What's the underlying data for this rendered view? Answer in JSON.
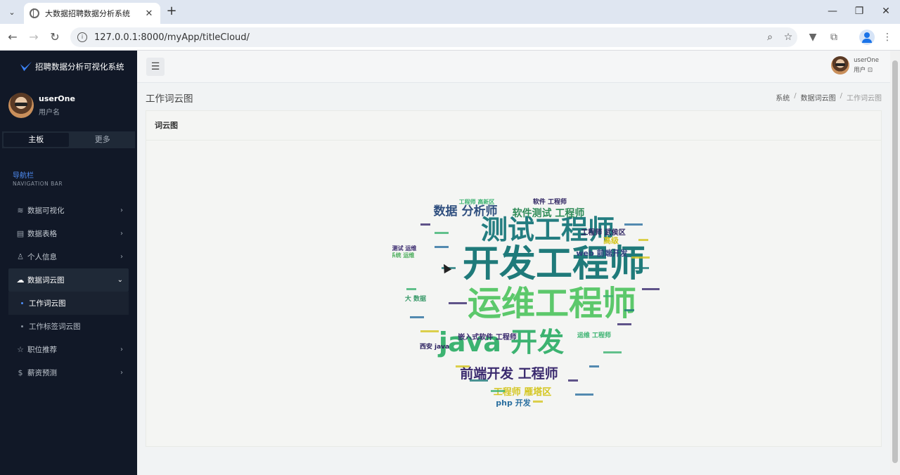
{
  "browser": {
    "tab_title": "大数据招聘数据分析系统",
    "url": "127.0.0.1:8000/myApp/titleCloud/"
  },
  "sidebar": {
    "brand": "招聘数据分析可视化系统",
    "user": {
      "name": "userOne",
      "role": "用户名"
    },
    "segments": [
      "主板",
      "更多"
    ],
    "nav_title": "导航栏",
    "nav_subtitle": "NAVIGATION BAR",
    "items": [
      {
        "label": "数据可视化",
        "icon": "layers-icon"
      },
      {
        "label": "数据表格",
        "icon": "table-icon"
      },
      {
        "label": "个人信息",
        "icon": "user-icon"
      },
      {
        "label": "数据词云图",
        "icon": "cloud-icon"
      },
      {
        "label": "职位推荐",
        "icon": "star-icon"
      },
      {
        "label": "薪资预测",
        "icon": "dollar-icon"
      }
    ],
    "sub_items": [
      "工作词云图",
      "工作标签词云图"
    ]
  },
  "topbar": {
    "user_name": "userOne",
    "user_role": "用户 ⊡"
  },
  "page": {
    "title": "工作词云图",
    "breadcrumb": [
      "系统",
      "数据词云图",
      "工作词云图"
    ],
    "card_title": "词云图"
  },
  "wordcloud": {
    "words": [
      {
        "text": "开发工程师",
        "color": "#1f7a7a"
      },
      {
        "text": "运维工程师",
        "color": "#5cc86b"
      },
      {
        "text": "测试工程师",
        "color": "#237d80"
      },
      {
        "text": "java 开发",
        "color": "#3cb371"
      },
      {
        "text": "前端开发 工程师",
        "color": "#3a2a6e"
      },
      {
        "text": "数据 分析师",
        "color": "#2f4f7f"
      },
      {
        "text": "软件测试 工程师",
        "color": "#2e8b57"
      },
      {
        "text": "工程师 雁塔区",
        "color": "#d4c620"
      },
      {
        "text": "web 前端开发",
        "color": "#2f3f7f"
      },
      {
        "text": "嵌入式软件 工程师",
        "color": "#3a2a6e"
      },
      {
        "text": "php 开发",
        "color": "#2a6f9f"
      },
      {
        "text": "高级",
        "color": "#d4c620"
      },
      {
        "text": "工程师 武侯区",
        "color": "#2a1f5e"
      },
      {
        "text": "软件 工程师",
        "color": "#2a1f5e"
      },
      {
        "text": "西安 java",
        "color": "#2a1f5e"
      },
      {
        "text": "测试 运维",
        "color": "#3a2a6e"
      },
      {
        "text": "系统 运维",
        "color": "#4cae5c"
      },
      {
        "text": "大 数据",
        "color": "#3a9a6a"
      },
      {
        "text": "运维 工程师",
        "color": "#3cb371"
      },
      {
        "text": "工程师 高新区",
        "color": "#3cb371"
      }
    ]
  }
}
